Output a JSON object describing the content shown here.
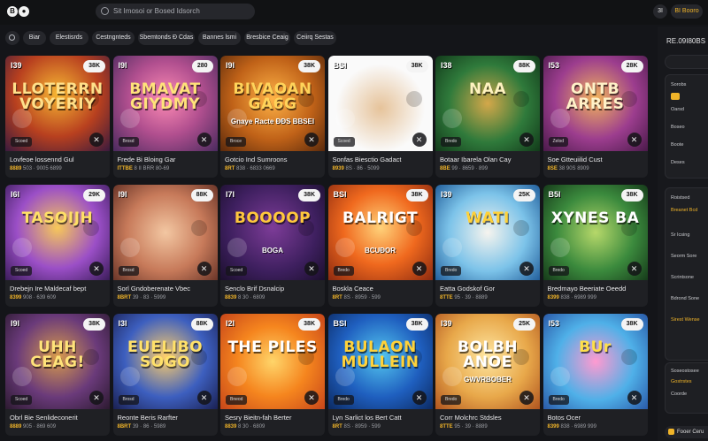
{
  "topbar": {
    "logo": "B",
    "search_placeholder": "Sit Imosoi or Bosed Idsorch",
    "btn_a": "3I",
    "btn_b": "BI Booro"
  },
  "chips": [
    "Biar",
    "Elestisrds",
    "Cestngnteds",
    "Sbemtonds Ð Cdas",
    "Bannes lsmi",
    "Bresbice Ceaig",
    "Ceiirq Sestas"
  ],
  "cards": [
    {
      "art_title": "LLOTERRN VOYERIY",
      "sub": "",
      "badge_l": "I39",
      "badge_r": "38K",
      "play": "Scoed",
      "name": "Lovfeoe lossennd Gul",
      "meta_a": "8889",
      "meta_b": "503 · 9005 6899"
    },
    {
      "art_title": "BMAVAT GIYDMY",
      "sub": "",
      "badge_l": "I9I",
      "badge_r": "280",
      "play": "Brosd",
      "name": "Frede Bi Bloing Gar",
      "meta_a": "ITTBE",
      "meta_b": "8 II BRR 80-69"
    },
    {
      "art_title": "BIVAOAN GA6G",
      "sub": "Gnaye Racte ÐÐS BBSEI",
      "badge_l": "I9I",
      "badge_r": "38K",
      "play": "Broce",
      "name": "Gotcio Ind Sumroons",
      "meta_a": "8RT",
      "meta_b": "838 · 6833 0669"
    },
    {
      "art_title": "",
      "sub": "",
      "badge_l": "BSI",
      "badge_r": "38K",
      "play": "Scoed",
      "name": "Sonfas Biesctio Gadact",
      "meta_a": "8939",
      "meta_b": "8S · 86 · 5099"
    },
    {
      "art_title": "NAA",
      "sub": "",
      "badge_l": "I38",
      "badge_r": "88K",
      "play": "Bredo",
      "name": "Botaar Ibarela Olan Cay",
      "meta_a": "8BE",
      "meta_b": "99 · 8659 · 899"
    },
    {
      "art_title": "ONTB ARRES",
      "sub": "",
      "badge_l": "I53",
      "badge_r": "28K",
      "play": "Zelod",
      "name": "Soe Gtteuiilid Cust",
      "meta_a": "8SE",
      "meta_b": "38 90S 8909"
    },
    {
      "art_title": "TASOIJH",
      "sub": "",
      "badge_l": "I6I",
      "badge_r": "29K",
      "play": "Scoed",
      "name": "Drebejn Ire Maldecaf bept",
      "meta_a": "8399",
      "meta_b": "908 · 639 609"
    },
    {
      "art_title": "",
      "sub": "",
      "badge_l": "I9I",
      "badge_r": "88K",
      "play": "Brosd",
      "name": "Sorl Gndoberenate Vbec",
      "meta_a": "8BRT",
      "meta_b": "39 · 83 · 5999"
    },
    {
      "art_title": "BOOOOP",
      "sub": "BOGA",
      "badge_l": "I7I",
      "badge_r": "38K",
      "play": "Scoed",
      "name": "Senclo Brif Dsnalcip",
      "meta_a": "8839",
      "meta_b": "8 30 · 6809"
    },
    {
      "art_title": "BALRIGT",
      "sub": "BCUÐOR",
      "badge_l": "BSI",
      "badge_r": "38K",
      "play": "Bredo",
      "name": "Boskla Ceace",
      "meta_a": "8RT",
      "meta_b": "8S · 8959 · 599"
    },
    {
      "art_title": "WATI",
      "sub": "",
      "badge_l": "I39",
      "badge_r": "25K",
      "play": "Bredo",
      "name": "Eatta Godskof Gor",
      "meta_a": "8TTE",
      "meta_b": "95 · 39 · 8889"
    },
    {
      "art_title": "XYNES BA",
      "sub": "",
      "badge_l": "B5I",
      "badge_r": "38K",
      "play": "Bredo",
      "name": "Bredmayo Beeriate Oeedd",
      "meta_a": "8399",
      "meta_b": "838 · 6989 999"
    },
    {
      "art_title": "UHH CEAG!",
      "sub": "",
      "badge_l": "I9I",
      "badge_r": "38K",
      "play": "Scoed",
      "name": "Obrl Bie Senlideconerit",
      "meta_a": "8889",
      "meta_b": "905 · 869 609"
    },
    {
      "art_title": "EUELIBO SOGO",
      "sub": "",
      "badge_l": "I3I",
      "badge_r": "88K",
      "play": "Brosd",
      "name": "Reonte Beris Rarfter",
      "meta_a": "8BRT",
      "meta_b": "39 · 86 · 5989"
    },
    {
      "art_title": "THE PILES",
      "sub": "",
      "badge_l": "I2I",
      "badge_r": "38K",
      "play": "Bneod",
      "name": "Sesry Bieitn-fah Berter",
      "meta_a": "8839",
      "meta_b": "8 30 · 6809"
    },
    {
      "art_title": "BULAON MULLEIN",
      "sub": "",
      "badge_l": "BSI",
      "badge_r": "38K",
      "play": "Bredo",
      "name": "Lyn Sarlict los Bert Catt",
      "meta_a": "8RT",
      "meta_b": "8S · 8959 · 599"
    },
    {
      "art_title": "BOLBH ANOE",
      "sub": "GWVRBOBER",
      "badge_l": "I39",
      "badge_r": "25K",
      "play": "Bredo",
      "name": "Corr Molchrc Stdsles",
      "meta_a": "8TTE",
      "meta_b": "95 · 39 · 8889"
    },
    {
      "art_title": "BUr",
      "sub": "",
      "badge_l": "I53",
      "badge_r": "38K",
      "play": "Bredo",
      "name": "Botos Ocer",
      "meta_a": "8399",
      "meta_b": "838 · 6989 999"
    }
  ],
  "side": {
    "title": "RE.09I80BS",
    "p1": [
      "Sorobs",
      "Oarsd",
      "Boseo",
      "Boote",
      "Deses"
    ],
    "p2": [
      "Roistsed",
      "Breanet Bcd",
      "Sr Icsing",
      "Seorm Sore",
      "Scrintsone",
      "Bdrond Sone",
      "Sirest Wense"
    ],
    "p3": [
      "Soseostosee",
      "Gostrstes",
      "Coorde"
    ],
    "footer": "Fooer Ceru"
  },
  "colors": {
    "accent": "#f0b429",
    "bg": "#141519",
    "card": "#1f2024"
  }
}
